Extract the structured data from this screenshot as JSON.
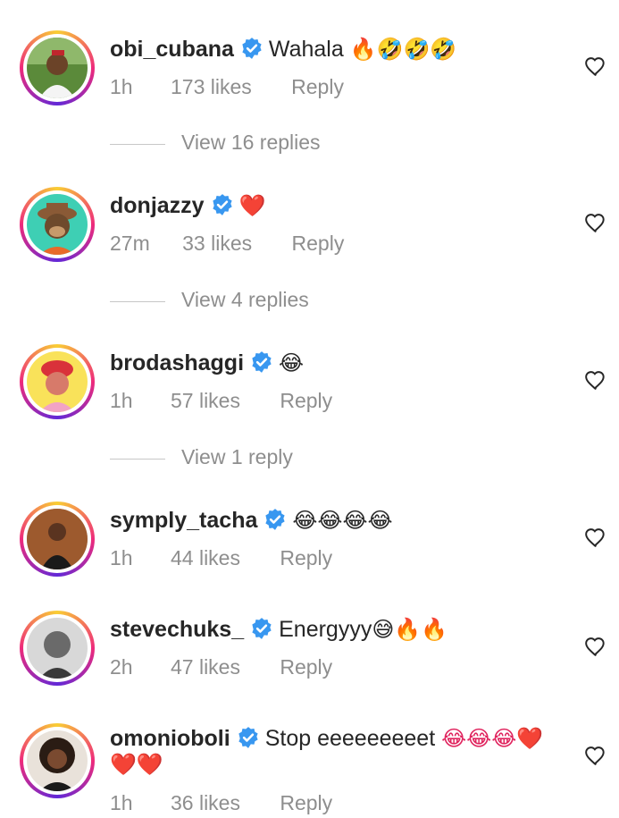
{
  "comments": [
    {
      "username": "obi_cubana",
      "text": "Wahala",
      "emoji": "🔥🤣🤣🤣",
      "time": "1h",
      "likes": "173 likes",
      "reply": "Reply",
      "view_replies": "View 16 replies"
    },
    {
      "username": "donjazzy",
      "text": "",
      "emoji": "❤️",
      "time": "27m",
      "likes": "33 likes",
      "reply": "Reply",
      "view_replies": "View 4 replies"
    },
    {
      "username": "brodashaggi",
      "text": "",
      "emoji": "😂",
      "time": "1h",
      "likes": "57 likes",
      "reply": "Reply",
      "view_replies": "View 1 reply"
    },
    {
      "username": "symply_tacha",
      "text": "",
      "emoji": "😂😂😂😂",
      "time": "1h",
      "likes": "44 likes",
      "reply": "Reply"
    },
    {
      "username": "stevechuks_",
      "text": "Energyyy",
      "emoji": "😅🔥🔥",
      "time": "2h",
      "likes": "47 likes",
      "reply": "Reply"
    },
    {
      "username": "omonioboli",
      "text": "Stop eeeeeeeeet",
      "emoji": "😂😂😂❤️",
      "emoji_line2": "❤️❤️",
      "time": "1h",
      "likes": "36 likes",
      "reply": "Reply"
    }
  ],
  "colors": {
    "text": "#262626",
    "secondary": "#8e8e8e",
    "verified": "#3897f0"
  }
}
